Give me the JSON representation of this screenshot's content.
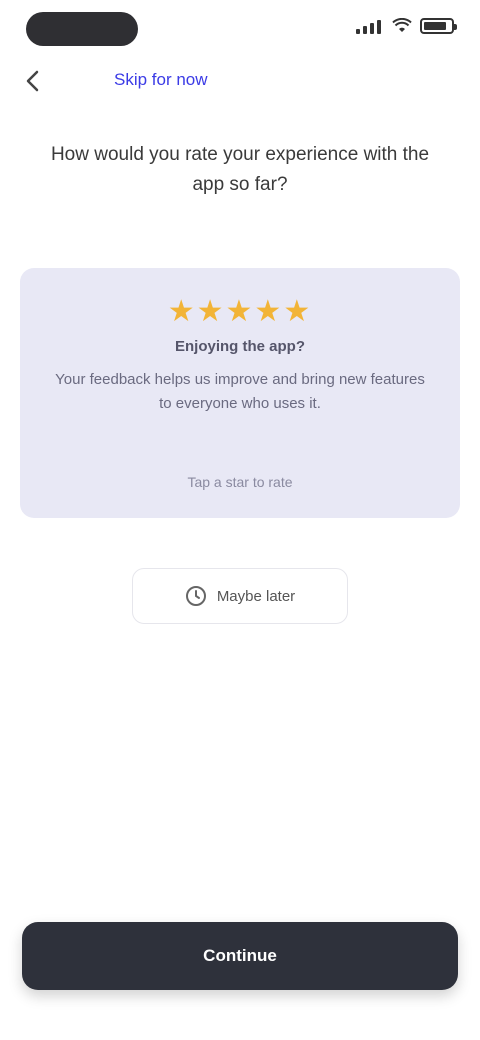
{
  "nav": {
    "link_label": "Skip for now"
  },
  "title": "How would you rate your experience with the app so far?",
  "card": {
    "stars": "★★★★★",
    "heading": "Enjoying the app?",
    "body": "Your feedback helps us improve and bring new features to everyone who uses it.",
    "footer": "Tap a star to rate"
  },
  "secondary_button": {
    "label": "Maybe later"
  },
  "primary_button": {
    "label": "Continue"
  },
  "colors": {
    "accent": "#3b3be6",
    "card_bg": "#e8e8f5",
    "star": "#f2b437",
    "primary_bg": "#2e313b"
  }
}
